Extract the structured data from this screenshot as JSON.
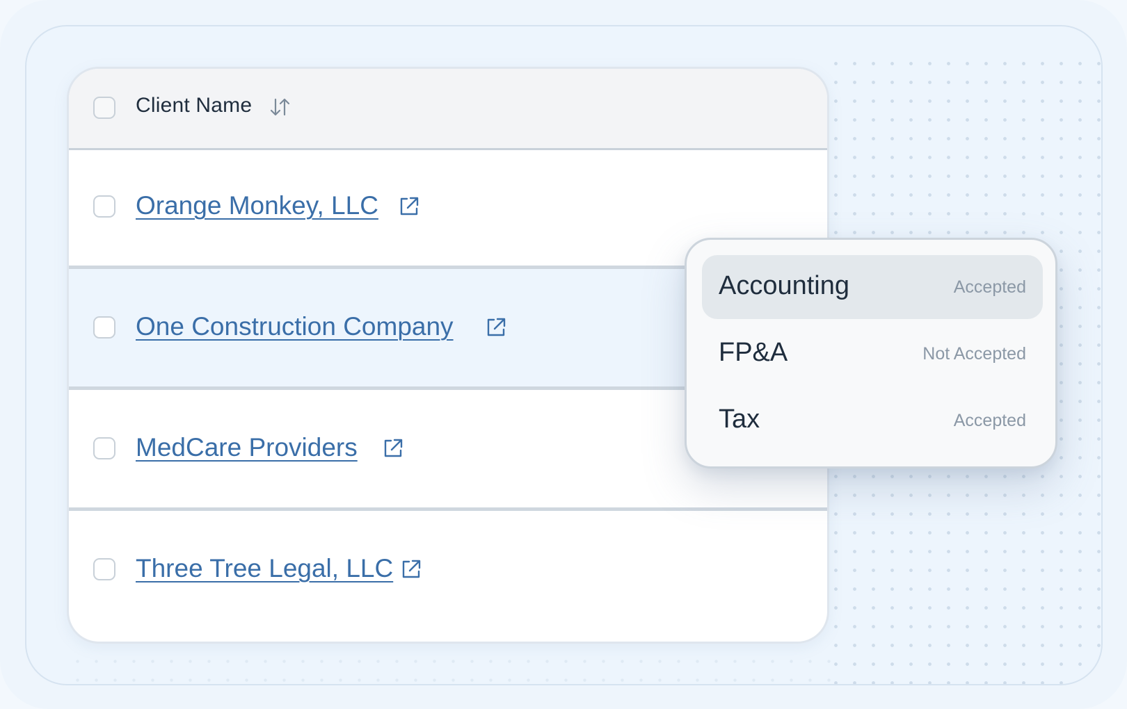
{
  "table": {
    "header_label": "Client Name",
    "rows": [
      {
        "name": "Orange Monkey, LLC"
      },
      {
        "name": "One Construction Company"
      },
      {
        "name": "MedCare Providers"
      },
      {
        "name": "Three Tree Legal, LLC"
      }
    ]
  },
  "dropdown": {
    "options": [
      {
        "label": "Accounting",
        "status": "Accepted"
      },
      {
        "label": "FP&A",
        "status": "Not Accepted"
      },
      {
        "label": "Tax",
        "status": "Accepted"
      }
    ]
  },
  "icons": {
    "sort": "sort-arrows-icon",
    "external": "external-link-icon"
  },
  "colors": {
    "link": "#3a6ea8",
    "highlight_row": "#edf5fd",
    "active_option": "#e3e8ec",
    "status_text": "#8b98a6"
  }
}
